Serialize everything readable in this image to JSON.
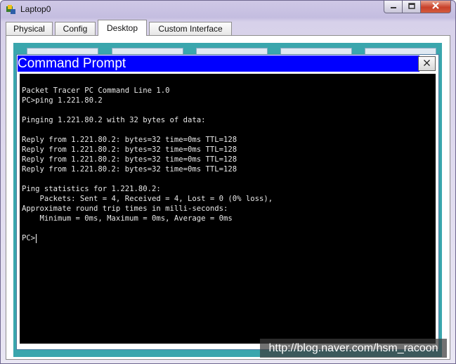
{
  "window": {
    "title": "Laptop0"
  },
  "tabs": [
    {
      "label": "Physical"
    },
    {
      "label": "Config"
    },
    {
      "label": "Desktop"
    },
    {
      "label": "Custom Interface"
    }
  ],
  "active_tab": "Desktop",
  "command_prompt": {
    "title": "Command Prompt",
    "close_label": "X",
    "lines": [
      "Packet Tracer PC Command Line 1.0",
      "PC>ping 1.221.80.2",
      "",
      "Pinging 1.221.80.2 with 32 bytes of data:",
      "",
      "Reply from 1.221.80.2: bytes=32 time=0ms TTL=128",
      "Reply from 1.221.80.2: bytes=32 time=0ms TTL=128",
      "Reply from 1.221.80.2: bytes=32 time=0ms TTL=128",
      "Reply from 1.221.80.2: bytes=32 time=0ms TTL=128",
      "",
      "Ping statistics for 1.221.80.2:",
      "    Packets: Sent = 4, Received = 4, Lost = 0 (0% loss),",
      "Approximate round trip times in milli-seconds:",
      "    Minimum = 0ms, Maximum = 0ms, Average = 0ms",
      ""
    ],
    "prompt": "PC>"
  },
  "watermark": "http://blog.naver.com/hsm_racoon",
  "colors": {
    "title_bar": "#0000ff",
    "terminal_bg": "#000000",
    "terminal_text": "#e8e8e8",
    "desktop_bg": "#3aa6ad",
    "close_button": "#c8402a"
  },
  "icons": {
    "app": "packet-tracer-icon",
    "minimize": "minimize-icon",
    "maximize": "maximize-icon",
    "close": "close-icon"
  }
}
